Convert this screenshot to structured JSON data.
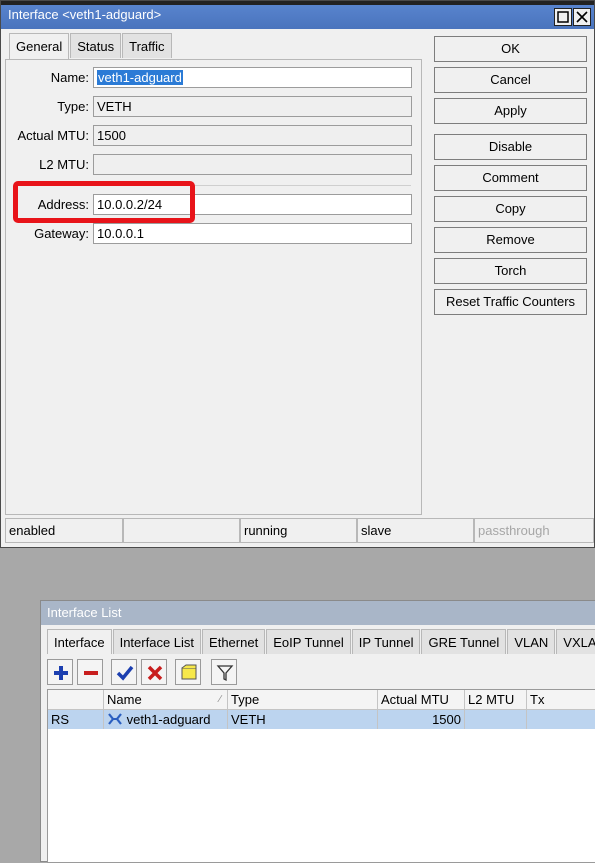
{
  "dialog": {
    "title": "Interface <veth1-adguard>",
    "tabs": [
      "General",
      "Status",
      "Traffic"
    ],
    "fields": {
      "name": {
        "label": "Name:",
        "value": "veth1-adguard"
      },
      "type": {
        "label": "Type:",
        "value": "VETH"
      },
      "actual_mtu": {
        "label": "Actual MTU:",
        "value": "1500"
      },
      "l2_mtu": {
        "label": "L2 MTU:",
        "value": ""
      },
      "address": {
        "label": "Address:",
        "value": "10.0.0.2/24"
      },
      "gateway": {
        "label": "Gateway:",
        "value": "10.0.0.1"
      }
    },
    "buttons": [
      "OK",
      "Cancel",
      "Apply",
      "Disable",
      "Comment",
      "Copy",
      "Remove",
      "Torch",
      "Reset Traffic Counters"
    ],
    "status": [
      "enabled",
      "",
      "running",
      "slave",
      "passthrough"
    ],
    "highlight_color": "#e8141a"
  },
  "list": {
    "title": "Interface List",
    "tabs": [
      "Interface",
      "Interface List",
      "Ethernet",
      "EoIP Tunnel",
      "IP Tunnel",
      "GRE Tunnel",
      "VLAN",
      "VXLA"
    ],
    "toolbar_icons": [
      "plus-icon",
      "minus-icon",
      "check-icon",
      "cross-icon",
      "note-icon",
      "filter-icon"
    ],
    "columns": [
      "",
      "Name",
      "Type",
      "Actual MTU",
      "L2 MTU",
      "Tx"
    ],
    "rows": [
      {
        "flags": "RS",
        "name": "veth1-adguard",
        "type": "VETH",
        "actual_mtu": "1500",
        "l2_mtu": "",
        "tx": ""
      }
    ],
    "row_highlight": "#bcd4ef"
  }
}
